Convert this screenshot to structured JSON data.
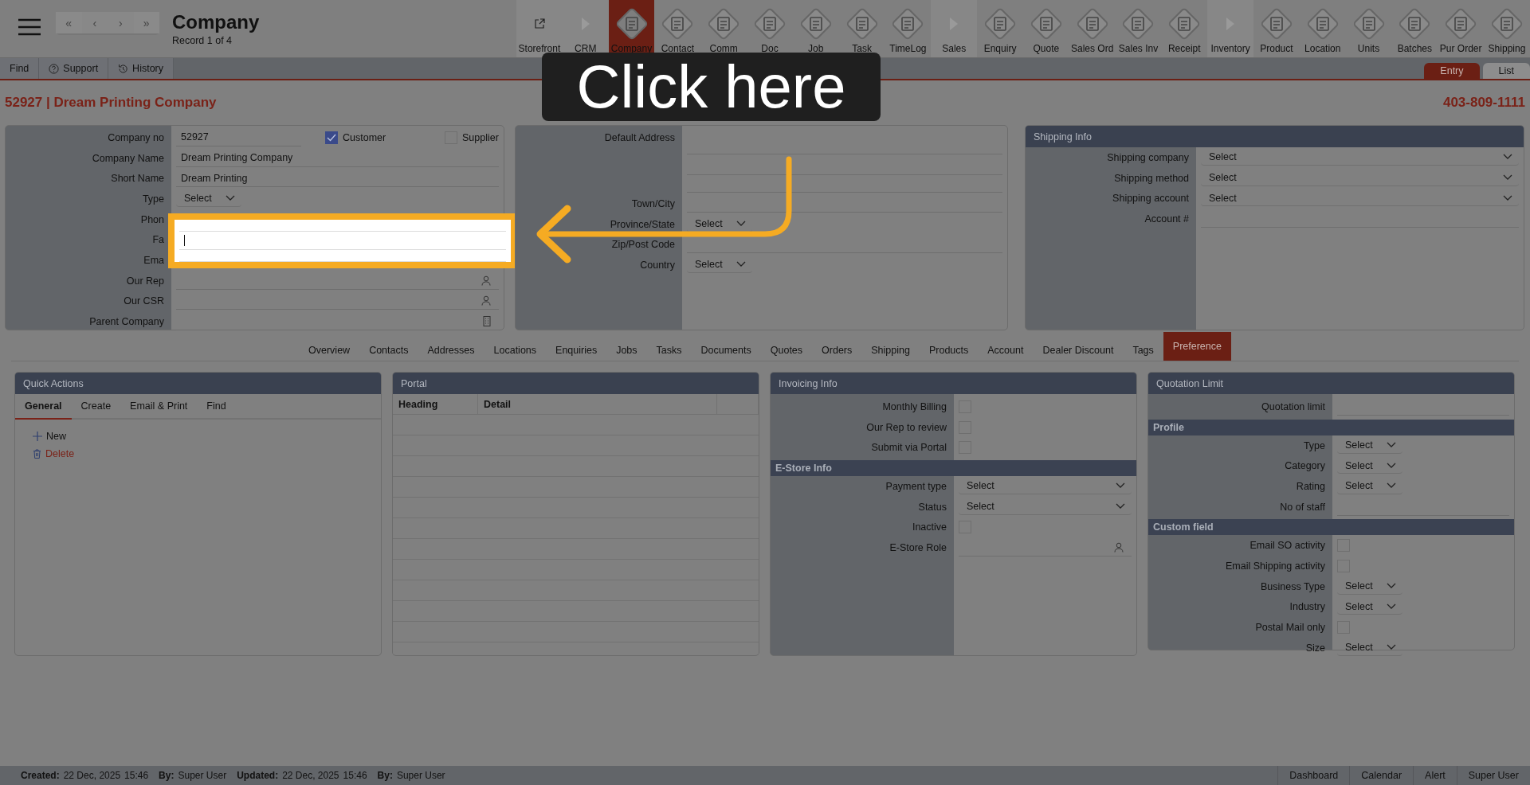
{
  "app_title": "Company",
  "record": "Record 1 of 4",
  "pager": [
    "«",
    "‹",
    "›",
    "»"
  ],
  "modules": [
    {
      "label": "Storefront",
      "kind": "link",
      "selected": false
    },
    {
      "label": "CRM",
      "kind": "section",
      "selected": false
    },
    {
      "label": "Company",
      "kind": "module",
      "selected": true
    },
    {
      "label": "Contact",
      "kind": "module",
      "selected": false
    },
    {
      "label": "Comm",
      "kind": "module",
      "selected": false
    },
    {
      "label": "Doc",
      "kind": "module",
      "selected": false
    },
    {
      "label": "Job",
      "kind": "module",
      "selected": false
    },
    {
      "label": "Task",
      "kind": "module",
      "selected": false
    },
    {
      "label": "TimeLog",
      "kind": "module",
      "selected": false
    },
    {
      "label": "Sales",
      "kind": "section",
      "selected": false
    },
    {
      "label": "Enquiry",
      "kind": "module",
      "selected": false
    },
    {
      "label": "Quote",
      "kind": "module",
      "selected": false
    },
    {
      "label": "Sales Ord",
      "kind": "module",
      "selected": false
    },
    {
      "label": "Sales Inv",
      "kind": "module",
      "selected": false
    },
    {
      "label": "Receipt",
      "kind": "module",
      "selected": false
    },
    {
      "label": "Inventory",
      "kind": "section",
      "selected": false
    },
    {
      "label": "Product",
      "kind": "module",
      "selected": false
    },
    {
      "label": "Location",
      "kind": "module",
      "selected": false
    },
    {
      "label": "Units",
      "kind": "module",
      "selected": false
    },
    {
      "label": "Batches",
      "kind": "module",
      "selected": false
    },
    {
      "label": "Pur Order",
      "kind": "module",
      "selected": false
    },
    {
      "label": "Shipping",
      "kind": "module",
      "selected": false
    }
  ],
  "toolbar": [
    {
      "label": "Find",
      "kind": "plain"
    },
    {
      "label": "Support",
      "kind": "help"
    },
    {
      "label": "History",
      "kind": "history"
    }
  ],
  "view_tabs": [
    {
      "label": "Entry",
      "selected": true
    },
    {
      "label": "List",
      "selected": false
    }
  ],
  "record_title": "52927 | Dream Printing Company",
  "record_phone": "403-809-1111",
  "company_form": {
    "rows_before": [
      {
        "label": "Company no",
        "kind": "text",
        "value": "52927",
        "checks": [
          {
            "label": "Customer",
            "checked": true
          },
          {
            "label": "Supplier",
            "checked": false
          }
        ]
      },
      {
        "label": "Company Name",
        "kind": "text",
        "value": "Dream Printing Company"
      },
      {
        "label": "Short Name",
        "kind": "text",
        "value": "Dream Printing"
      },
      {
        "label": "Type",
        "kind": "select-small",
        "value": "Select"
      }
    ],
    "highlighted": [
      {
        "label": "Phon",
        "focused": false
      },
      {
        "label": "Fa",
        "focused": true
      },
      {
        "label": "Ema",
        "focused": false
      }
    ],
    "rows_after": [
      {
        "label": "Our Rep",
        "kind": "lookup-person"
      },
      {
        "label": "Our CSR",
        "kind": "lookup-person"
      },
      {
        "label": "Parent Company",
        "kind": "lookup-building"
      }
    ]
  },
  "address_form": {
    "rows": [
      {
        "label": "Default Address",
        "kind": "textarea"
      },
      {
        "label": "Town/City",
        "kind": "text"
      },
      {
        "label": "Province/State",
        "kind": "select-small",
        "value": "Select"
      },
      {
        "label": "Zip/Post Code",
        "kind": "text"
      },
      {
        "label": "Country",
        "kind": "select-small",
        "value": "Select"
      }
    ]
  },
  "shipping_info": {
    "title": "Shipping Info",
    "rows": [
      {
        "label": "Shipping company",
        "kind": "select",
        "value": "Select"
      },
      {
        "label": "Shipping method",
        "kind": "select",
        "value": "Select"
      },
      {
        "label": "Shipping account",
        "kind": "select",
        "value": "Select"
      },
      {
        "label": "Account #",
        "kind": "text"
      }
    ]
  },
  "record_tabs": [
    {
      "label": "Overview",
      "selected": false
    },
    {
      "label": "Contacts",
      "selected": false
    },
    {
      "label": "Addresses",
      "selected": false
    },
    {
      "label": "Locations",
      "selected": false
    },
    {
      "label": "Enquiries",
      "selected": false
    },
    {
      "label": "Jobs",
      "selected": false
    },
    {
      "label": "Tasks",
      "selected": false
    },
    {
      "label": "Documents",
      "selected": false
    },
    {
      "label": "Quotes",
      "selected": false
    },
    {
      "label": "Orders",
      "selected": false
    },
    {
      "label": "Shipping",
      "selected": false
    },
    {
      "label": "Products",
      "selected": false
    },
    {
      "label": "Account",
      "selected": false
    },
    {
      "label": "Dealer Discount",
      "selected": false
    },
    {
      "label": "Tags",
      "selected": false
    },
    {
      "label": "Preference",
      "selected": true
    }
  ],
  "quick_actions": {
    "title": "Quick Actions",
    "tabs": [
      {
        "label": "General",
        "selected": true
      },
      {
        "label": "Create",
        "selected": false
      },
      {
        "label": "Email & Print",
        "selected": false
      },
      {
        "label": "Find",
        "selected": false
      }
    ],
    "actions": [
      {
        "label": "New",
        "kind": "new"
      },
      {
        "label": "Delete",
        "kind": "delete"
      }
    ]
  },
  "portal": {
    "title": "Portal",
    "columns": [
      "Heading",
      "Detail"
    ]
  },
  "invoicing_info": {
    "title": "Invoicing Info",
    "items": [
      {
        "label": "Monthly Billing",
        "kind": "checkbox",
        "checked": false
      },
      {
        "label": "Our Rep to review",
        "kind": "checkbox",
        "checked": false
      },
      {
        "label": "Submit via Portal",
        "kind": "checkbox",
        "checked": false
      },
      {
        "label": "E-Store Info",
        "kind": "section"
      },
      {
        "label": "Payment type",
        "kind": "select",
        "value": "Select"
      },
      {
        "label": "Status",
        "kind": "select",
        "value": "Select"
      },
      {
        "label": "Inactive",
        "kind": "checkbox",
        "checked": false
      },
      {
        "label": "E-Store Role",
        "kind": "lookup-person"
      }
    ]
  },
  "quotation_limit": {
    "title": "Quotation Limit",
    "items": [
      {
        "label": "Quotation limit",
        "kind": "text"
      },
      {
        "label": "Profile",
        "kind": "section"
      },
      {
        "label": "Type",
        "kind": "select-small",
        "value": "Select"
      },
      {
        "label": "Category",
        "kind": "select-small",
        "value": "Select"
      },
      {
        "label": "Rating",
        "kind": "select-small",
        "value": "Select"
      },
      {
        "label": "No of staff",
        "kind": "text"
      },
      {
        "label": "Custom field",
        "kind": "section"
      },
      {
        "label": "Email SO activity",
        "kind": "checkbox",
        "checked": false
      },
      {
        "label": "Email Shipping activity",
        "kind": "checkbox",
        "checked": false
      },
      {
        "label": "Business Type",
        "kind": "select-small",
        "value": "Select"
      },
      {
        "label": "Industry",
        "kind": "select-small",
        "value": "Select"
      },
      {
        "label": "Postal Mail only",
        "kind": "checkbox",
        "checked": false
      },
      {
        "label": "Size",
        "kind": "select-small",
        "value": "Select"
      }
    ]
  },
  "tooltip": "Click here",
  "footer": {
    "info": [
      {
        "kind": "label",
        "text": "Created:"
      },
      {
        "kind": "value",
        "text": "22 Dec, 2025"
      },
      {
        "kind": "value",
        "text": "15:46"
      },
      {
        "kind": "label",
        "text": "By:"
      },
      {
        "kind": "value",
        "text": "Super User"
      },
      {
        "kind": "label",
        "text": "Updated:"
      },
      {
        "kind": "value",
        "text": "22 Dec, 2025"
      },
      {
        "kind": "value",
        "text": "15:46"
      },
      {
        "kind": "label",
        "text": "By:"
      },
      {
        "kind": "value",
        "text": "Super User"
      }
    ],
    "links": [
      "Dashboard",
      "Calendar",
      "Alert",
      "Super User"
    ]
  }
}
